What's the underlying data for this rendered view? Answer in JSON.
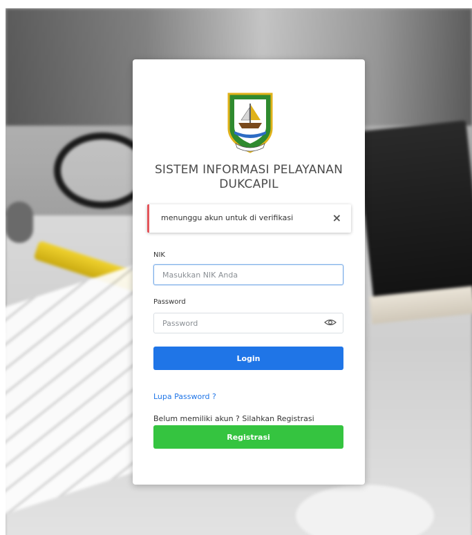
{
  "app": {
    "title": "SISTEM INFORMASI PELAYANAN DUKCAPIL",
    "title_line1": "SISTEM INFORMASI PELAYANAN",
    "title_line2": "DUKCAPIL"
  },
  "alert": {
    "message": "menunggu akun untuk di verifikasi",
    "close_glyph": "×",
    "accent": "#e4555b"
  },
  "form": {
    "nik": {
      "label": "NIK",
      "placeholder": "Masukkan NIK Anda",
      "value": ""
    },
    "password": {
      "label": "Password",
      "placeholder": "Password",
      "value": "",
      "toggle_icon": "eye-icon"
    },
    "login_label": "Login",
    "forgot_label": "Lupa Password ?",
    "register_prompt": "Belum memiliki akun ? Silahkan Registrasi",
    "register_label": "Registrasi"
  },
  "colors": {
    "primary": "#1f75e7",
    "success": "#35c440",
    "danger": "#e4555b",
    "logo_green": "#2f8a2f",
    "logo_gold": "#e0b21a"
  },
  "icons": [
    "emblem-logo",
    "close-icon",
    "eye-icon"
  ]
}
